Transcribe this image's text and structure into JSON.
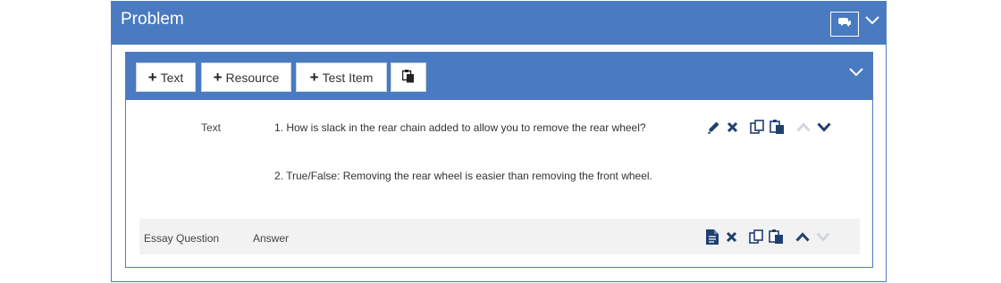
{
  "panel": {
    "title": "Problem",
    "icons": {
      "comment": "comment-icon",
      "collapse": "chevron-down-icon"
    }
  },
  "toolbar": {
    "buttons": [
      {
        "label": "Text",
        "icon": "plus-icon"
      },
      {
        "label": "Resource",
        "icon": "plus-icon"
      },
      {
        "label": "Test Item",
        "icon": "plus-icon"
      },
      {
        "label": "",
        "icon": "paste-icon"
      }
    ]
  },
  "items": [
    {
      "type_label": "Text",
      "lines": [
        "1. How is slack in the rear chain added to allow you to remove the rear wheel?",
        "2. True/False: Removing the rear wheel is easier than removing the front wheel."
      ],
      "actions": [
        "edit-icon",
        "delete-icon",
        "copy-icon",
        "paste-icon",
        "move-up-icon",
        "move-down-icon"
      ],
      "move_up_enabled": false,
      "move_down_enabled": true
    },
    {
      "type_label": "Essay Question",
      "answer_label": "Answer",
      "actions": [
        "document-icon",
        "delete-icon",
        "copy-icon",
        "paste-icon",
        "move-up-icon",
        "move-down-icon"
      ],
      "move_up_enabled": true,
      "move_down_enabled": false
    }
  ],
  "colors": {
    "header": "#4a7abf",
    "icon": "#1f3f6e",
    "disabled_icon": "#d0d6de"
  }
}
